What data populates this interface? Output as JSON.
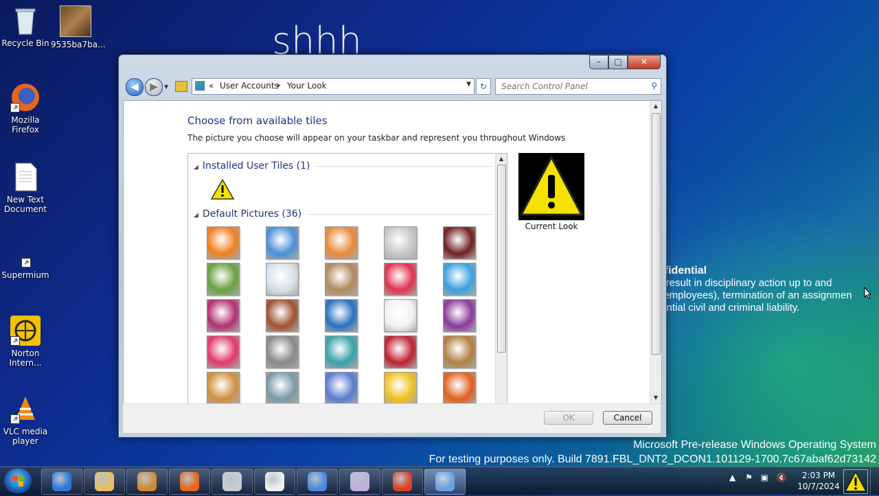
{
  "desktop": {
    "overlay_text": "shhh",
    "icons": [
      {
        "label": "Recycle Bin"
      },
      {
        "label": "9535ba7ba..."
      },
      {
        "label": "Mozilla Firefox"
      },
      {
        "label": "New Text Document"
      },
      {
        "label": "Supermium"
      },
      {
        "label": "Norton Intern..."
      },
      {
        "label": "VLC media player"
      }
    ],
    "confidential": {
      "title": "nfidential",
      "lines": [
        "y result in disciplinary action up to and",
        "f employees), termination of an assignmen",
        "tential civil and criminal liability."
      ]
    },
    "watermark": {
      "line1": "Microsoft Pre-release Windows Operating System",
      "line2": "For testing purposes only. Build 7891.FBL_DNT2_DCON1.101129-1700.7c67abaf62d73142"
    }
  },
  "window": {
    "caption_buttons": {
      "minimize": "–",
      "maximize": "□",
      "close": "✕"
    },
    "breadcrumb": {
      "chevrons": "«",
      "item1": "User Accounts",
      "sep": "▸",
      "item2": "Your Look"
    },
    "search": {
      "placeholder": "Search Control Panel",
      "value": ""
    },
    "heading": "Choose from available tiles",
    "description": "The picture you choose will appear on your taskbar and represent you throughout Windows",
    "groups": {
      "installed": "Installed User Tiles (1)",
      "default": "Default Pictures (36)"
    },
    "current_look_label": "Current Look",
    "buttons": {
      "ok": "OK",
      "cancel": "Cancel"
    },
    "tile_colors": [
      [
        "#f08020",
        "#4a8fd8",
        "#e88a3a",
        "#c8c8c8",
        "#702020"
      ],
      [
        "#6aa040",
        "#d8e0e8",
        "#b08a60",
        "#e03050",
        "#3aa0e0"
      ],
      [
        "#b03070",
        "#a05030",
        "#2a70c0",
        "#f2f2f2",
        "#8a3a9a"
      ],
      [
        "#e03a6a",
        "#888888",
        "#3aa0a8",
        "#c02030",
        "#b08040"
      ],
      [
        "#d09040",
        "#7a9aa8",
        "#5a7ad0",
        "#f0c020",
        "#e06020"
      ]
    ]
  },
  "taskbar": {
    "clock_time": "2:03 PM",
    "clock_date": "10/7/2024",
    "apps": [
      "internet-explorer",
      "windows-explorer",
      "media-player",
      "firefox",
      "drive",
      "panda",
      "bird-app",
      "paint",
      "pointer-app",
      "control-panel"
    ]
  }
}
